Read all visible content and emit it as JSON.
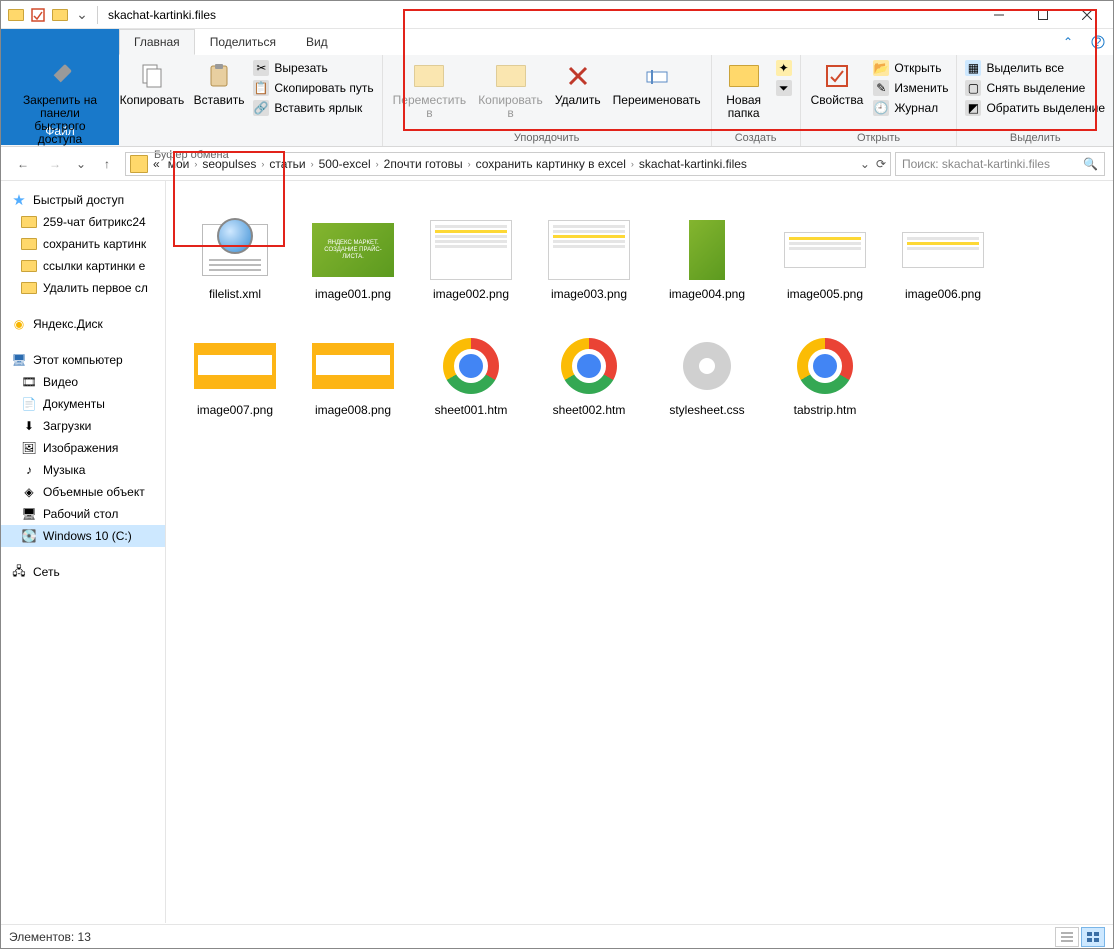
{
  "window": {
    "title": "skachat-kartinki.files"
  },
  "tabs": {
    "file": "Файл",
    "home": "Главная",
    "share": "Поделиться",
    "view": "Вид"
  },
  "ribbon": {
    "pin": "Закрепить на панели\nбыстрого доступа",
    "copy": "Копировать",
    "paste": "Вставить",
    "cut": "Вырезать",
    "copypath": "Скопировать путь",
    "pasteshortcut": "Вставить ярлык",
    "clipboard_label": "Буфер обмена",
    "moveto": "Переместить\nв",
    "copyto": "Копировать\nв",
    "delete": "Удалить",
    "rename": "Переименовать",
    "organize_label": "Упорядочить",
    "newfolder": "Новая\nпапка",
    "create_label": "Создать",
    "properties": "Свойства",
    "open": "Открыть",
    "edit": "Изменить",
    "history": "Журнал",
    "open_label": "Открыть",
    "selectall": "Выделить все",
    "selectnone": "Снять выделение",
    "invert": "Обратить выделение",
    "select_label": "Выделить"
  },
  "breadcrumb": {
    "segments": [
      "мои",
      "seopulses",
      "статьи",
      "500-excel",
      "2почти готовы",
      "сохранить картинку в excel",
      "skachat-kartinki.files"
    ],
    "prefix": "«"
  },
  "search": {
    "placeholder": "Поиск: skachat-kartinki.files"
  },
  "nav": {
    "quick": "Быстрый доступ",
    "quick_items": [
      "259-чат битрикс24",
      "сохранить картинк",
      "ссылки картинки е",
      "Удалить первое сл"
    ],
    "yadisk": "Яндекс.Диск",
    "thispc": "Этот компьютер",
    "pc_items": [
      "Видео",
      "Документы",
      "Загрузки",
      "Изображения",
      "Музыка",
      "Объемные объект",
      "Рабочий стол",
      "Windows 10 (C:)"
    ],
    "network": "Сеть"
  },
  "files": [
    {
      "name": "filelist.xml",
      "type": "xml"
    },
    {
      "name": "image001.png",
      "type": "green"
    },
    {
      "name": "image002.png",
      "type": "page"
    },
    {
      "name": "image003.png",
      "type": "page"
    },
    {
      "name": "image004.png",
      "type": "green-tall"
    },
    {
      "name": "image005.png",
      "type": "page"
    },
    {
      "name": "image006.png",
      "type": "page"
    },
    {
      "name": "image007.png",
      "type": "yellow"
    },
    {
      "name": "image008.png",
      "type": "yellow"
    },
    {
      "name": "sheet001.htm",
      "type": "chrome"
    },
    {
      "name": "sheet002.htm",
      "type": "chrome"
    },
    {
      "name": "stylesheet.css",
      "type": "gear"
    },
    {
      "name": "tabstrip.htm",
      "type": "chrome"
    }
  ],
  "status": {
    "elements_label": "Элементов:",
    "elements_count": "13"
  },
  "thumb_text": {
    "image001": "ЯНДЕКС МАРКЕТ. СОЗДАНИЕ ПРАЙС-ЛИСТА."
  }
}
